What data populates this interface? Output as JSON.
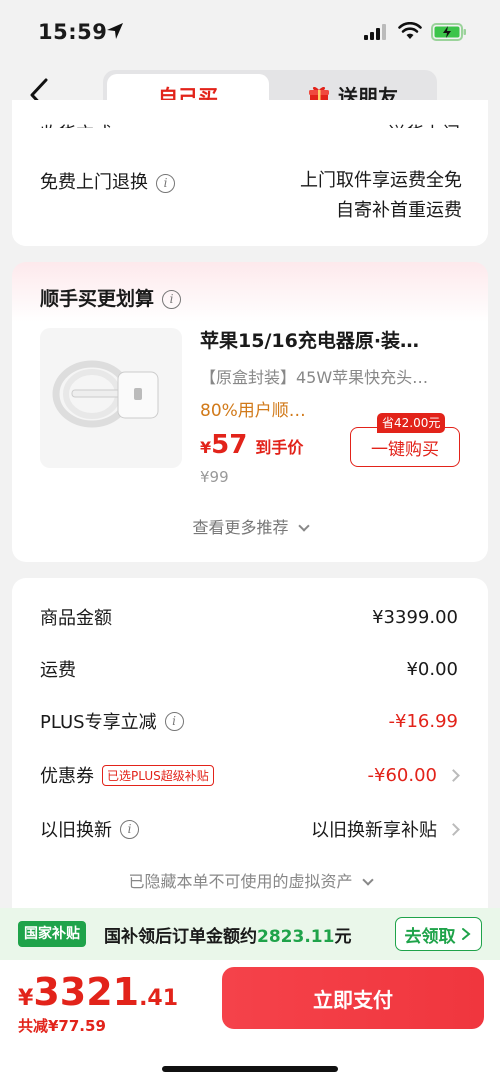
{
  "status": {
    "time": "15:59"
  },
  "nav": {
    "tab_self": "自己买",
    "tab_gift": "送朋友"
  },
  "card1": {
    "cut_left": "收货方式",
    "cut_right": "送货上门",
    "return_label": "免费上门退换",
    "return_line1": "上门取件享运费全免",
    "return_line2": "自寄补首重运费"
  },
  "recommend": {
    "title": "顺手买更划算",
    "product_name": "苹果15/16充电器原·装…",
    "product_desc": "【原盒封装】45W苹果快充头…",
    "tag": "80%用户顺…",
    "currency": "¥",
    "price": "57",
    "price_suffix": "到手价",
    "orig_price": "¥99",
    "save_badge": "省42.00元",
    "buy_button": "一键购买",
    "more": "查看更多推荐"
  },
  "summary": {
    "items": [
      {
        "label": "商品金额",
        "value": "¥3399.00"
      },
      {
        "label": "运费",
        "value": "¥0.00"
      },
      {
        "label": "PLUS专享立减",
        "value": "-¥16.99"
      },
      {
        "label": "优惠券",
        "value": "-¥60.00",
        "tag": "已选PLUS超级补贴"
      },
      {
        "label": "以旧换新",
        "value": "以旧换新享补贴"
      }
    ],
    "hidden_assets": "已隐藏本单不可使用的虚拟资产"
  },
  "subsidy": {
    "badge": "国家补贴",
    "text": "国补领后订单金额约",
    "amount": "2823.11",
    "unit": "元",
    "button": "去领取"
  },
  "footer": {
    "currency": "¥",
    "total_int": "3321",
    "total_dec": ".41",
    "saved": "共减¥77.59",
    "pay_button": "立即支付"
  },
  "colors": {
    "accent": "#e2231a",
    "green": "#1fa34a"
  }
}
